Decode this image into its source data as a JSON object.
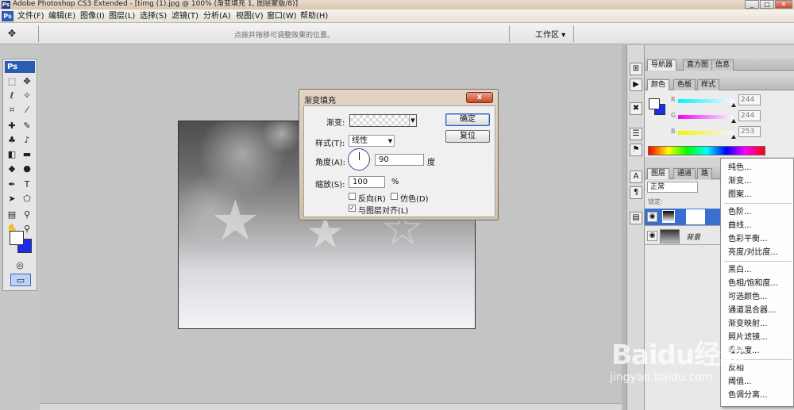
{
  "app": {
    "title": "Adobe Photoshop CS3 Extended - [timg (1).jpg @ 100% (渐变填充 1, 图层蒙版/8)]",
    "logo": "Ps",
    "logo_small": "Ps"
  },
  "window_controls": {
    "minimize": "_",
    "maximize": "□",
    "close": "✕"
  },
  "menu": {
    "items": [
      "文件(F)",
      "编辑(E)",
      "图像(I)",
      "图层(L)",
      "选择(S)",
      "滤镜(T)",
      "分析(A)",
      "视图(V)",
      "窗口(W)",
      "帮助(H)"
    ]
  },
  "options_bar": {
    "tool_glyph": "✥",
    "hint": "点按并拖移可调整效果的位置。",
    "workspace": "工作区 ▾"
  },
  "tools": {
    "ps_label": "Ps",
    "fg_color": "#ffffff",
    "bg_color": "#1a2cf0"
  },
  "dialog": {
    "title": "渐变填充",
    "close": "x",
    "gradient_label": "渐变:",
    "style_label": "样式(T):",
    "style_value": "线性",
    "angle_label": "角度(A):",
    "angle_value": "90",
    "angle_unit": "度",
    "scale_label": "缩放(S):",
    "scale_value": "100",
    "scale_unit": "%",
    "reverse_label": "反向(R)",
    "dither_label": "仿色(D)",
    "align_label": "与图层对齐(L)",
    "reverse_checked": false,
    "dither_checked": false,
    "align_checked": true,
    "ok_label": "确定",
    "reset_label": "复位"
  },
  "panels": {
    "navigator_tabs": [
      "导航器",
      "直方图",
      "信息"
    ],
    "color_tabs": [
      "颜色",
      "色板",
      "样式"
    ],
    "color": {
      "r_label": "R",
      "g_label": "G",
      "b_label": "B",
      "r_value": "244",
      "g_value": "244",
      "b_value": "253",
      "fg_color": "#ffffff",
      "bg_color": "#1a2cf0"
    },
    "layers_tabs": [
      "图层",
      "通道",
      "路"
    ],
    "layers": {
      "blend_mode": "正常",
      "lock_label": "锁定:",
      "rows": [
        {
          "name": "",
          "type": "gradient-fill-layer"
        },
        {
          "name": "背景",
          "type": "background"
        }
      ]
    }
  },
  "context_menu": {
    "group1": [
      "纯色...",
      "渐变...",
      "图案..."
    ],
    "group2": [
      "色阶...",
      "曲线...",
      "色彩平衡...",
      "亮度/对比度..."
    ],
    "group3": [
      "黑白...",
      "色相/饱和度...",
      "可选颜色...",
      "通道混合器...",
      "渐变映射...",
      "照片滤镜...",
      "曝光度..."
    ],
    "group4": [
      "反相",
      "阈值...",
      "色调分离..."
    ]
  },
  "watermark": {
    "brand": "Baidu经验",
    "url": "jingyan.baidu.com"
  }
}
